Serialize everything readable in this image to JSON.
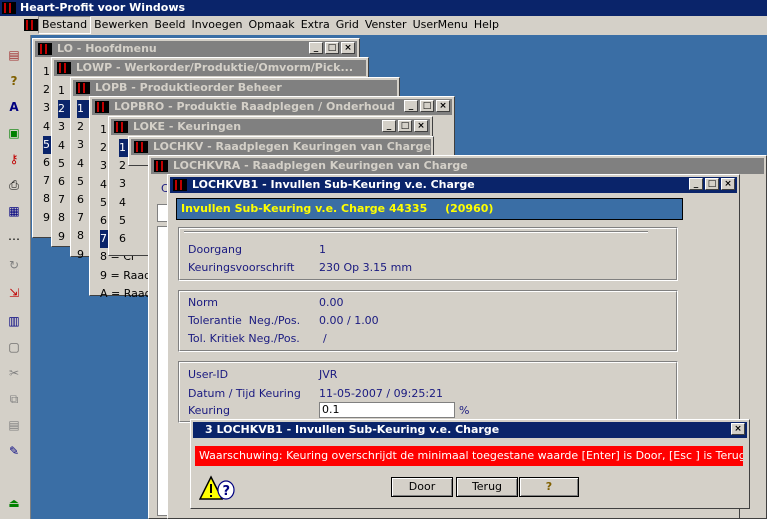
{
  "app": {
    "title": "Heart-Profit voor Windows"
  },
  "menu": [
    "Bestand",
    "Bewerken",
    "Beeld",
    "Invoegen",
    "Opmaak",
    "Extra",
    "Grid",
    "Venster",
    "UserMenu",
    "Help"
  ],
  "windows": {
    "lo": {
      "title": "LO - Hoofdmenu",
      "rows": [
        "1",
        "2",
        "3",
        "4",
        "5",
        "6",
        "7",
        "8",
        "9"
      ]
    },
    "lowp": {
      "title": "LOWP - Werkorder/Produktie/Omvorm/Pick...",
      "rows": [
        "1",
        "2",
        "3",
        "4",
        "5",
        "6",
        "7",
        "8",
        "9"
      ]
    },
    "lopb": {
      "title": "LOPB - Produktieorder Beheer",
      "rows": [
        "1",
        "2",
        "3",
        "4",
        "5",
        "6",
        "7",
        "8",
        "9"
      ]
    },
    "lopbro": {
      "title": "LOPBRO - Produktie Raadplegen / Onderhoud",
      "rows": [
        "1",
        "2",
        "3",
        "4",
        "5",
        "6",
        "7"
      ],
      "extra": [
        "8 = Ci",
        "9 = Raad",
        "A = Raadp"
      ]
    },
    "loke": {
      "title": "LOKE - Keuringen",
      "rows": [
        "1",
        "2",
        "3",
        "4",
        "5",
        "6"
      ]
    },
    "lochkv": {
      "title": "LOCHKV - Raadplegen Keuringen van Charge"
    },
    "lochkvra": {
      "title": "LOCHKVRA - Raadplegen Keuringen van Charge",
      "peek": "C"
    },
    "lochkvb1": {
      "title": "LOCHKVB1 - Invullen Sub-Keuring v.e. Charge",
      "header": "Invullen Sub-Keuring v.e. Charge 44335",
      "header_code": "(20960)",
      "doorgang_label": "Doorgang",
      "doorgang_value": "1",
      "voorschrift_label": "Keuringsvoorschrift",
      "voorschrift_value": "230 Op 3.15 mm",
      "norm_label": "Norm",
      "norm_value": "0.00",
      "tolerantie_label": "Tolerantie  Neg./Pos.",
      "tolerantie_value": "0.00 / 1.00",
      "kritiek_label": "Tol. Kritiek Neg./Pos.",
      "kritiek_value": "/",
      "userid_label": "User-ID",
      "userid_value": "JVR",
      "datum_label": "Datum / Tijd Keuring",
      "datum_value": "11-05-2007 / 09:25:21",
      "keuring_label": "Keuring",
      "keuring_value": "0.1",
      "keuring_unit": "%"
    }
  },
  "dialog": {
    "title": "3 LOCHKVB1 - Invullen Sub-Keuring v.e. Charge",
    "message": "Waarschuwing: Keuring overschrijdt de minimaal toegestane waarde [Enter] is Door, [Esc  ] is Terug",
    "door_label": "Door",
    "terug_label": "Terug",
    "help_label": "?",
    "colors": {
      "message_bg": "#ff0000",
      "message_text": "#ffffff"
    }
  },
  "win_buttons": {
    "min": "_",
    "max": "□",
    "close": "×"
  },
  "toolbar_icons": [
    "report-icon",
    "help-icon",
    "font-icon",
    "screen-icon",
    "key-icon",
    "printer-icon",
    "form-icon",
    "dots-icon",
    "refresh-icon",
    "export-icon",
    "chart-icon",
    "window-icon",
    "scissors-icon",
    "copy-icon",
    "paste-icon",
    "edit-icon",
    "exit-icon"
  ]
}
